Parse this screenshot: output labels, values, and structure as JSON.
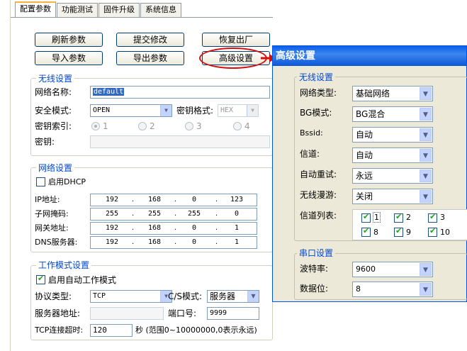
{
  "config": {
    "tabs": [
      "配置参数",
      "功能测试",
      "固件升级",
      "系统信息"
    ],
    "buttons": {
      "refresh": "刷新参数",
      "submit": "提交修改",
      "restore": "恢复出厂",
      "import": "导入参数",
      "export": "导出参数",
      "advanced": "高级设置"
    },
    "wireless": {
      "title": "无线设置",
      "ssid_label": "网络名称:",
      "ssid_value": "default",
      "security_label": "安全模式:",
      "security_value": "OPEN",
      "key_format_label": "密钥格式:",
      "key_format_value": "HEX",
      "key_index_label": "密钥索引:",
      "key_index_options": [
        "1",
        "2",
        "3",
        "4"
      ],
      "key_label": "密钥:",
      "key_value": ""
    },
    "network": {
      "title": "网络设置",
      "dhcp_label": "启用DHCP",
      "dhcp_checked": false,
      "ip_label": "IP地址:",
      "ip": [
        "192",
        "168",
        "0",
        "123"
      ],
      "mask_label": "子网掩码:",
      "mask": [
        "255",
        "255",
        "255",
        "0"
      ],
      "gateway_label": "网关地址:",
      "gateway": [
        "192",
        "168",
        "0",
        "1"
      ],
      "dns_label": "DNS服务器:",
      "dns": [
        "192",
        "168",
        "0",
        "1"
      ]
    },
    "mode": {
      "title": "工作模式设置",
      "auto_label": "启用自动工作模式",
      "auto_checked": true,
      "protocol_label": "协议类型:",
      "protocol_value": "TCP",
      "cs_label": "C/S模式:",
      "cs_value": "服务器",
      "server_addr_label": "服务器地址:",
      "server_addr_value": "",
      "port_label": "端口号:",
      "port_value": "9999",
      "timeout_label": "TCP连接超时:",
      "timeout_value": "120",
      "timeout_hint": "秒 (范围0~10000000,0表示永远)"
    }
  },
  "advanced": {
    "title": "高级设置",
    "wireless_title": "无线设置",
    "fields": [
      {
        "label": "网络类型:",
        "value": "基础网络"
      },
      {
        "label": "BG模式:",
        "value": "BG混合"
      },
      {
        "label": "Bssid:",
        "value": "自动"
      },
      {
        "label": "信道:",
        "value": "自动"
      },
      {
        "label": "自动重试:",
        "value": "永远"
      },
      {
        "label": "无线漫游:",
        "value": "关闭"
      }
    ],
    "channel_list_label": "信道列表:",
    "channels": [
      "1",
      "2",
      "3",
      "8",
      "9",
      "10"
    ],
    "serial_title": "串口设置",
    "baud_label": "波特率:",
    "baud_value": "9600",
    "databits_label": "数据位:",
    "databits_value": "8"
  },
  "colors": {
    "highlight": "#d20f0f",
    "titlebar": "#0a5ee8",
    "group_title": "#0046d5"
  }
}
